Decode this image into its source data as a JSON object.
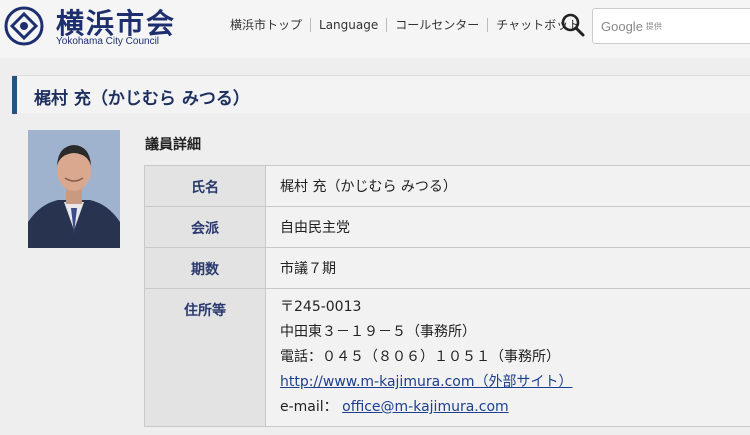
{
  "header": {
    "brand_jp": "横浜市会",
    "brand_en": "Yokohama City Council",
    "nav": [
      "横浜市トップ",
      "Language",
      "コールセンター",
      "チャットボット"
    ],
    "search": {
      "engine": "Google",
      "suffix": "提供"
    }
  },
  "page": {
    "title": "梶村 充（かじむら みつる）"
  },
  "detail": {
    "heading": "議員詳細",
    "rows": [
      {
        "label": "氏名",
        "value": "梶村 充（かじむら みつる）"
      },
      {
        "label": "会派",
        "value": "自由民主党"
      },
      {
        "label": "期数",
        "value": "市議７期"
      }
    ],
    "address": {
      "label": "住所等",
      "postal": "〒245-0013",
      "street": "中田東３－１９－５（事務所）",
      "phone": "電話：０４５（８０６）１０５１（事務所）",
      "url": "http://www.m-kajimura.com（外部サイト）",
      "email_label": "e-mail：",
      "email": "office@m-kajimura.com"
    }
  },
  "colors": {
    "accent": "#27517f",
    "brand": "#1d2f6e",
    "link": "#1c3f8f"
  }
}
